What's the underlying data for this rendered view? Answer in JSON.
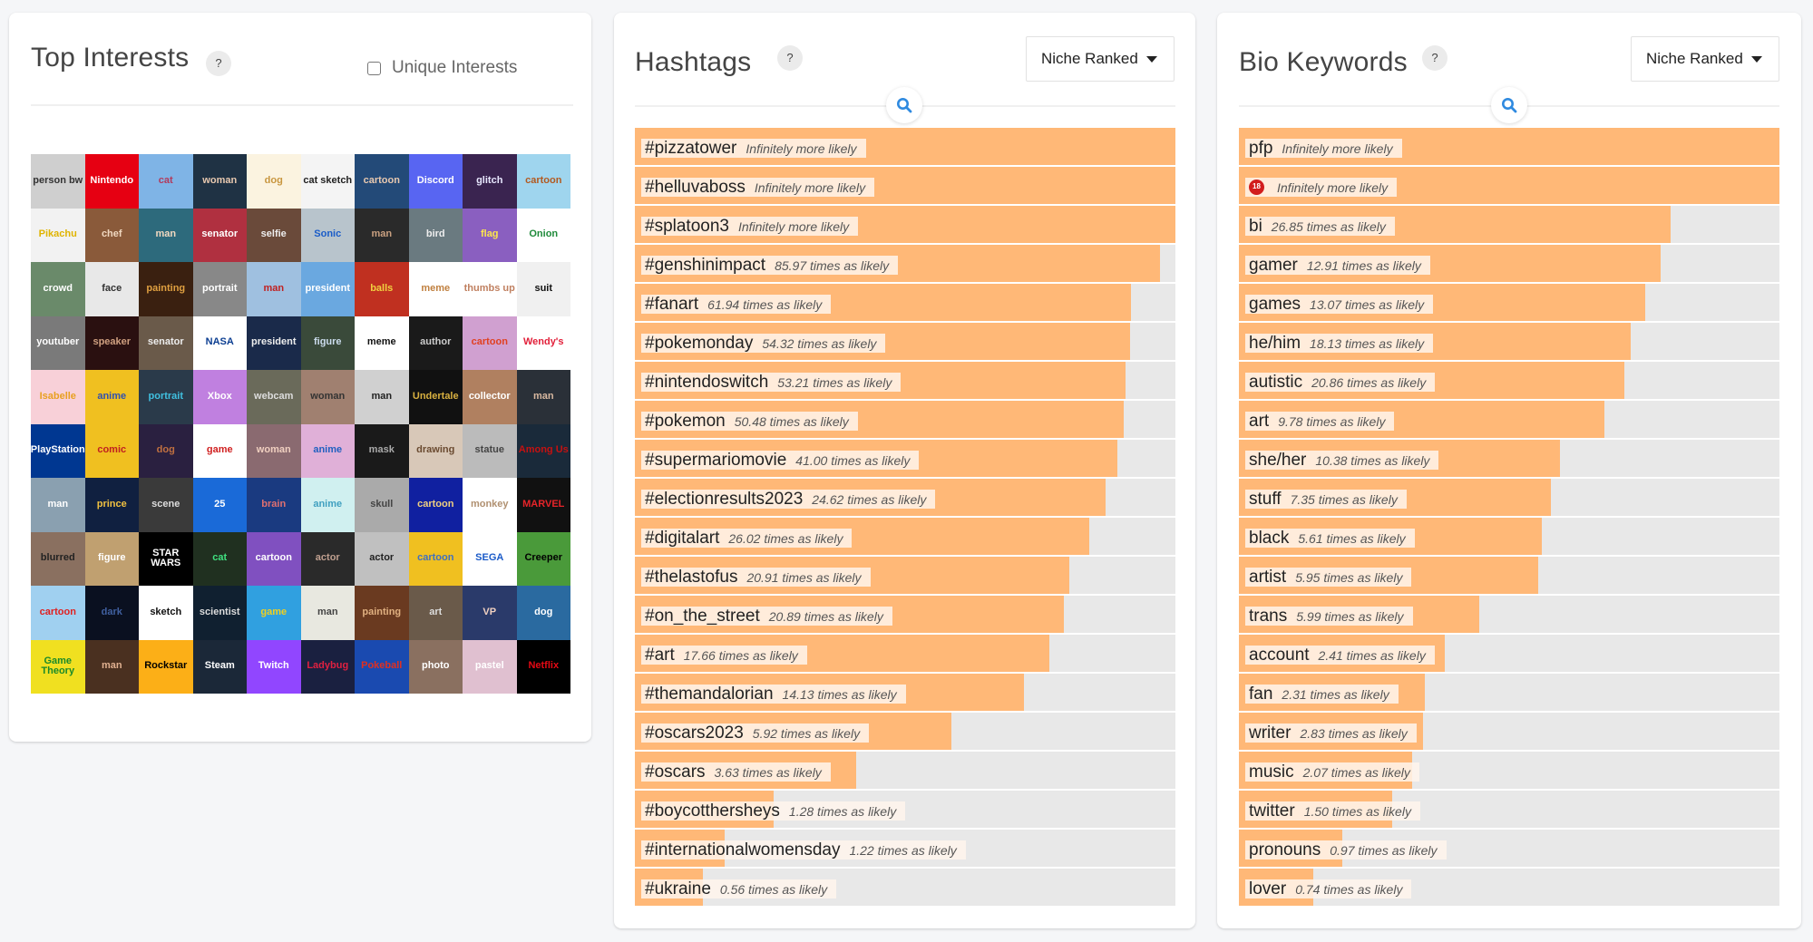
{
  "interests": {
    "title": "Top Interests",
    "help": "?",
    "unique_checkbox": {
      "label": "Unique Interests",
      "checked": false
    },
    "tiles": [
      {
        "label": "person bw",
        "bg": "#cfcfcf",
        "fg": "#333"
      },
      {
        "label": "Nintendo",
        "bg": "#e60012",
        "fg": "#fff"
      },
      {
        "label": "cat",
        "bg": "#7fb4e6",
        "fg": "#b23a5c"
      },
      {
        "label": "woman",
        "bg": "#1f3244",
        "fg": "#e8c9b0"
      },
      {
        "label": "dog",
        "bg": "#fbf3e0",
        "fg": "#c8963f"
      },
      {
        "label": "cat sketch",
        "bg": "#f4f4f4",
        "fg": "#222"
      },
      {
        "label": "cartoon",
        "bg": "#234a78",
        "fg": "#e8c9b0"
      },
      {
        "label": "Discord",
        "bg": "#5865f2",
        "fg": "#fff"
      },
      {
        "label": "glitch",
        "bg": "#3a2450",
        "fg": "#e8e8ff"
      },
      {
        "label": "cartoon",
        "bg": "#9fd5ee",
        "fg": "#b25a20"
      },
      {
        "label": "Pikachu",
        "bg": "#f2f2f2",
        "fg": "#e0b400"
      },
      {
        "label": "chef",
        "bg": "#8a5a3a",
        "fg": "#f0d8c0"
      },
      {
        "label": "man",
        "bg": "#2d6a7c",
        "fg": "#f0d8c0"
      },
      {
        "label": "senator",
        "bg": "#b03040",
        "fg": "#fff"
      },
      {
        "label": "selfie",
        "bg": "#6a4a3a",
        "fg": "#eee"
      },
      {
        "label": "Sonic",
        "bg": "#b8c4cc",
        "fg": "#1a5cc8"
      },
      {
        "label": "man",
        "bg": "#2a2a2a",
        "fg": "#c9a080"
      },
      {
        "label": "bird",
        "bg": "#6a7a80",
        "fg": "#eee"
      },
      {
        "label": "flag",
        "bg": "#8a5fc0",
        "fg": "#fde74c"
      },
      {
        "label": "Onion",
        "bg": "#ffffff",
        "fg": "#1f8a3a"
      },
      {
        "label": "crowd",
        "bg": "#6a8a6a",
        "fg": "#fff"
      },
      {
        "label": "face",
        "bg": "#e8e8e8",
        "fg": "#333"
      },
      {
        "label": "painting",
        "bg": "#3a2010",
        "fg": "#e0a040"
      },
      {
        "label": "portrait",
        "bg": "#888",
        "fg": "#fff"
      },
      {
        "label": "man",
        "bg": "#9fc0e0",
        "fg": "#c02020"
      },
      {
        "label": "president",
        "bg": "#6aa8e0",
        "fg": "#fff"
      },
      {
        "label": "balls",
        "bg": "#c03020",
        "fg": "#f0d040"
      },
      {
        "label": "meme",
        "bg": "#ffffff",
        "fg": "#c08040"
      },
      {
        "label": "thumbs up",
        "bg": "#ffffff",
        "fg": "#c08060"
      },
      {
        "label": "suit",
        "bg": "#f0f0f0",
        "fg": "#111"
      },
      {
        "label": "youtuber",
        "bg": "#7a7a7a",
        "fg": "#fff"
      },
      {
        "label": "speaker",
        "bg": "#2a1010",
        "fg": "#d0a080"
      },
      {
        "label": "senator",
        "bg": "#6a5a4a",
        "fg": "#eee"
      },
      {
        "label": "NASA",
        "bg": "#ffffff",
        "fg": "#0b3d91"
      },
      {
        "label": "president",
        "bg": "#1a2a4a",
        "fg": "#eee"
      },
      {
        "label": "figure",
        "bg": "#3a4a3a",
        "fg": "#cde"
      },
      {
        "label": "meme",
        "bg": "#ffffff",
        "fg": "#111"
      },
      {
        "label": "author",
        "bg": "#1a1a1a",
        "fg": "#ccc"
      },
      {
        "label": "cartoon",
        "bg": "#d0a0d0",
        "fg": "#e04020"
      },
      {
        "label": "Wendy's",
        "bg": "#ffffff",
        "fg": "#e2203a"
      },
      {
        "label": "Isabelle",
        "bg": "#f8d0d8",
        "fg": "#e8a020"
      },
      {
        "label": "anime",
        "bg": "#f0c020",
        "fg": "#3050b0"
      },
      {
        "label": "portrait",
        "bg": "#2a3a4a",
        "fg": "#40c0e0"
      },
      {
        "label": "Xbox",
        "bg": "#c080e0",
        "fg": "#fff"
      },
      {
        "label": "webcam",
        "bg": "#6a6a5a",
        "fg": "#ddd"
      },
      {
        "label": "woman",
        "bg": "#a08070",
        "fg": "#333"
      },
      {
        "label": "man",
        "bg": "#d0d0d0",
        "fg": "#222"
      },
      {
        "label": "Undertale",
        "bg": "#111111",
        "fg": "#d8b040"
      },
      {
        "label": "collector",
        "bg": "#b08060",
        "fg": "#fff"
      },
      {
        "label": "man",
        "bg": "#2a3038",
        "fg": "#d8b8a0"
      },
      {
        "label": "PlayStation",
        "bg": "#003791",
        "fg": "#fff"
      },
      {
        "label": "comic",
        "bg": "#f0c020",
        "fg": "#c02020"
      },
      {
        "label": "dog",
        "bg": "#2a2040",
        "fg": "#c07040"
      },
      {
        "label": "game",
        "bg": "#ffffff",
        "fg": "#d02020"
      },
      {
        "label": "woman",
        "bg": "#8a6a70",
        "fg": "#f0d0c0"
      },
      {
        "label": "anime",
        "bg": "#e0b0d8",
        "fg": "#2060c0"
      },
      {
        "label": "mask",
        "bg": "#1a1a1a",
        "fg": "#aaa"
      },
      {
        "label": "drawing",
        "bg": "#d8c8b8",
        "fg": "#6a4a30"
      },
      {
        "label": "statue",
        "bg": "#bbbbbb",
        "fg": "#444"
      },
      {
        "label": "Among Us",
        "bg": "#1a2a3a",
        "fg": "#c51111"
      },
      {
        "label": "man",
        "bg": "#8aa0b0",
        "fg": "#fff"
      },
      {
        "label": "prince",
        "bg": "#102040",
        "fg": "#f0c040"
      },
      {
        "label": "scene",
        "bg": "#3a3a3a",
        "fg": "#ddd"
      },
      {
        "label": "25",
        "bg": "#1a6ad8",
        "fg": "#fff"
      },
      {
        "label": "brain",
        "bg": "#1a3a80",
        "fg": "#e07070"
      },
      {
        "label": "anime",
        "bg": "#d0f0f0",
        "fg": "#40a0c0"
      },
      {
        "label": "skull",
        "bg": "#aaaaaa",
        "fg": "#444"
      },
      {
        "label": "cartoon",
        "bg": "#1020a0",
        "fg": "#f0d080"
      },
      {
        "label": "monkey",
        "bg": "#ffffff",
        "fg": "#b09070"
      },
      {
        "label": "MARVEL",
        "bg": "#111111",
        "fg": "#e62429"
      },
      {
        "label": "blurred",
        "bg": "#8a7060",
        "fg": "#222"
      },
      {
        "label": "figure",
        "bg": "#c0a070",
        "fg": "#fff"
      },
      {
        "label": "STAR WARS",
        "bg": "#000000",
        "fg": "#ffffff"
      },
      {
        "label": "cat",
        "bg": "#203020",
        "fg": "#40e080"
      },
      {
        "label": "cartoon",
        "bg": "#8050c0",
        "fg": "#fff"
      },
      {
        "label": "actor",
        "bg": "#2a2a2a",
        "fg": "#c0a090"
      },
      {
        "label": "actor",
        "bg": "#c0c0c0",
        "fg": "#222"
      },
      {
        "label": "cartoon",
        "bg": "#f0c020",
        "fg": "#4070c0"
      },
      {
        "label": "SEGA",
        "bg": "#ffffff",
        "fg": "#1a5ac8"
      },
      {
        "label": "Creeper",
        "bg": "#4a9a3a",
        "fg": "#000"
      },
      {
        "label": "cartoon",
        "bg": "#a0d0f0",
        "fg": "#e02020"
      },
      {
        "label": "dark",
        "bg": "#0a1020",
        "fg": "#4060a0"
      },
      {
        "label": "sketch",
        "bg": "#ffffff",
        "fg": "#111"
      },
      {
        "label": "scientist",
        "bg": "#102030",
        "fg": "#ddd"
      },
      {
        "label": "game",
        "bg": "#30a0e0",
        "fg": "#f0d020"
      },
      {
        "label": "man",
        "bg": "#e8e8e0",
        "fg": "#444"
      },
      {
        "label": "painting",
        "bg": "#6a3a20",
        "fg": "#e0b080"
      },
      {
        "label": "art",
        "bg": "#6a5a4a",
        "fg": "#ddd"
      },
      {
        "label": "VP",
        "bg": "#2a3a6a",
        "fg": "#f0d0c0"
      },
      {
        "label": "dog",
        "bg": "#2a6aa0",
        "fg": "#fff"
      },
      {
        "label": "Game Theory",
        "bg": "#f0e020",
        "fg": "#1a8a2a"
      },
      {
        "label": "man",
        "bg": "#4a3020",
        "fg": "#e0b090"
      },
      {
        "label": "Rockstar",
        "bg": "#fcaf17",
        "fg": "#000"
      },
      {
        "label": "Steam",
        "bg": "#1b2838",
        "fg": "#fff"
      },
      {
        "label": "Twitch",
        "bg": "#9146ff",
        "fg": "#fff"
      },
      {
        "label": "Ladybug",
        "bg": "#1a2040",
        "fg": "#e02040"
      },
      {
        "label": "Pokeball",
        "bg": "#1a4ab0",
        "fg": "#e03020"
      },
      {
        "label": "photo",
        "bg": "#8a7060",
        "fg": "#fff"
      },
      {
        "label": "pastel",
        "bg": "#e0c0d0",
        "fg": "#fff"
      },
      {
        "label": "Netflix",
        "bg": "#000000",
        "fg": "#e50914"
      }
    ]
  },
  "hashtags": {
    "title": "Hashtags",
    "help": "?",
    "sort_dropdown": "Niche Ranked",
    "rows": [
      {
        "term": "#pizzatower",
        "desc": "Infinitely more likely",
        "fill": 1.0
      },
      {
        "term": "#helluvaboss",
        "desc": "Infinitely more likely",
        "fill": 1.0
      },
      {
        "term": "#splatoon3",
        "desc": "Infinitely more likely",
        "fill": 1.0
      },
      {
        "term": "#genshinimpact",
        "desc": "85.97 times as likely",
        "fill": 0.972
      },
      {
        "term": "#fanart",
        "desc": "61.94 times as likely",
        "fill": 0.918
      },
      {
        "term": "#pokemonday",
        "desc": "54.32 times as likely",
        "fill": 0.916
      },
      {
        "term": "#nintendoswitch",
        "desc": "53.21 times as likely",
        "fill": 0.907
      },
      {
        "term": "#pokemon",
        "desc": "50.48 times as likely",
        "fill": 0.905
      },
      {
        "term": "#supermariomovie",
        "desc": "41.00 times as likely",
        "fill": 0.893
      },
      {
        "term": "#electionresults2023",
        "desc": "24.62 times as likely",
        "fill": 0.871
      },
      {
        "term": "#digitalart",
        "desc": "26.02 times as likely",
        "fill": 0.84
      },
      {
        "term": "#thelastofus",
        "desc": "20.91 times as likely",
        "fill": 0.803
      },
      {
        "term": "#on_the_street",
        "desc": "20.89 times as likely",
        "fill": 0.794
      },
      {
        "term": "#art",
        "desc": "17.66 times as likely",
        "fill": 0.767
      },
      {
        "term": "#themandalorian",
        "desc": "14.13 times as likely",
        "fill": 0.72
      },
      {
        "term": "#oscars2023",
        "desc": "5.92 times as likely",
        "fill": 0.585
      },
      {
        "term": "#oscars",
        "desc": "3.63 times as likely",
        "fill": 0.41
      },
      {
        "term": "#boycotthersheys",
        "desc": "1.28 times as likely",
        "fill": 0.256
      },
      {
        "term": "#internationalwomensday",
        "desc": "1.22 times as likely",
        "fill": 0.166
      },
      {
        "term": "#ukraine",
        "desc": "0.56 times as likely",
        "fill": 0.125
      }
    ]
  },
  "bio": {
    "title": "Bio Keywords",
    "help": "?",
    "sort_dropdown": "Niche Ranked",
    "rows": [
      {
        "term": "pfp",
        "desc": "Infinitely more likely",
        "fill": 1.0
      },
      {
        "term": "",
        "emoji": "no-under-18-emoji",
        "desc": "Infinitely more likely",
        "fill": 1.0
      },
      {
        "term": "bi",
        "desc": "26.85 times as likely",
        "fill": 0.799
      },
      {
        "term": "gamer",
        "desc": "12.91 times as likely",
        "fill": 0.78
      },
      {
        "term": "games",
        "desc": "13.07 times as likely",
        "fill": 0.752
      },
      {
        "term": "he/him",
        "desc": "18.13 times as likely",
        "fill": 0.725
      },
      {
        "term": "autistic",
        "desc": "20.86 times as likely",
        "fill": 0.713
      },
      {
        "term": "art",
        "desc": "9.78 times as likely",
        "fill": 0.677
      },
      {
        "term": "she/her",
        "desc": "10.38 times as likely",
        "fill": 0.594
      },
      {
        "term": "stuff",
        "desc": "7.35 times as likely",
        "fill": 0.578
      },
      {
        "term": "black",
        "desc": "5.61 times as likely",
        "fill": 0.561
      },
      {
        "term": "artist",
        "desc": "5.95 times as likely",
        "fill": 0.554
      },
      {
        "term": "trans",
        "desc": "5.99 times as likely",
        "fill": 0.445
      },
      {
        "term": "account",
        "desc": "2.41 times as likely",
        "fill": 0.381
      },
      {
        "term": "fan",
        "desc": "2.31 times as likely",
        "fill": 0.344
      },
      {
        "term": "writer",
        "desc": "2.83 times as likely",
        "fill": 0.341
      },
      {
        "term": "music",
        "desc": "2.07 times as likely",
        "fill": 0.321
      },
      {
        "term": "twitter",
        "desc": "1.50 times as likely",
        "fill": 0.283
      },
      {
        "term": "pronouns",
        "desc": "0.97 times as likely",
        "fill": 0.192
      },
      {
        "term": "lover",
        "desc": "0.74 times as likely",
        "fill": 0.137
      }
    ]
  },
  "colors": {
    "bar_fill": "#ffb877",
    "bar_track": "#e8e8e8",
    "search_icon": "#2f8ae0"
  }
}
